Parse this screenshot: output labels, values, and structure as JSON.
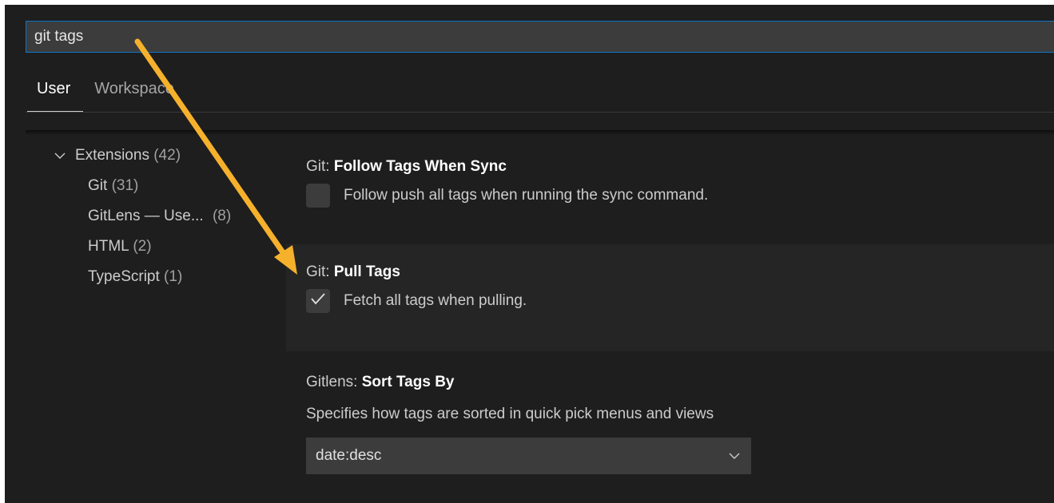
{
  "search": {
    "value": "git tags"
  },
  "tabs": [
    {
      "label": "User",
      "active": true
    },
    {
      "label": "Workspace",
      "active": false
    }
  ],
  "toc": {
    "group": {
      "label": "Extensions",
      "count": "(42)"
    },
    "items": [
      {
        "label": "Git",
        "count": "(31)"
      },
      {
        "label": "GitLens — Use...",
        "count": "(8)"
      },
      {
        "label": "HTML",
        "count": "(2)"
      },
      {
        "label": "TypeScript",
        "count": "(1)"
      }
    ]
  },
  "settings": [
    {
      "category": "Git: ",
      "key": "Follow Tags When Sync",
      "description": "Follow push all tags when running the sync command.",
      "checked": false
    },
    {
      "category": "Git: ",
      "key": "Pull Tags",
      "description": "Fetch all tags when pulling.",
      "checked": true
    },
    {
      "category": "Gitlens: ",
      "key": "Sort Tags By",
      "description": "Specifies how tags are sorted in quick pick menus and views",
      "selected": "date:desc"
    }
  ],
  "icons": {
    "toc_chevron": "chevron-down-icon",
    "check": "check-icon",
    "select_caret": "chevron-down-icon",
    "annotation": "arrow-annotation"
  },
  "colors": {
    "background": "#1e1e1e",
    "focus_border": "#0e74c9",
    "annotation_arrow": "#f6b12c",
    "input_background": "#3c3c3c"
  }
}
